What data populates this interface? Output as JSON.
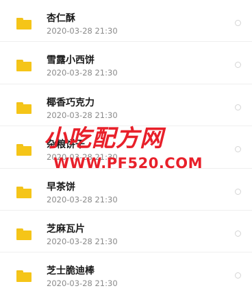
{
  "files": [
    {
      "name": "杏仁酥",
      "date": "2020-03-28  21:30"
    },
    {
      "name": "雪露小西饼",
      "date": "2020-03-28  21:30"
    },
    {
      "name": "椰香巧克力",
      "date": "2020-03-28  21:30"
    },
    {
      "name": "杂粮饼干",
      "date": "2020-03-28  21:30"
    },
    {
      "name": "早茶饼",
      "date": "2020-03-28  21:30"
    },
    {
      "name": "芝麻瓦片",
      "date": "2020-03-28  21:30"
    },
    {
      "name": "芝士脆迪棒",
      "date": "2020-03-28  21:30"
    }
  ],
  "watermark": {
    "title": "小吃配方网",
    "url": "WWW.PF520.COM"
  },
  "icons": {
    "file": "folder-icon",
    "select": "radio-icon"
  },
  "colors": {
    "folder": "#f5c518",
    "watermark": "#e8202a",
    "title_text": "#1a1a1a",
    "meta_text": "#8a8a8a"
  }
}
